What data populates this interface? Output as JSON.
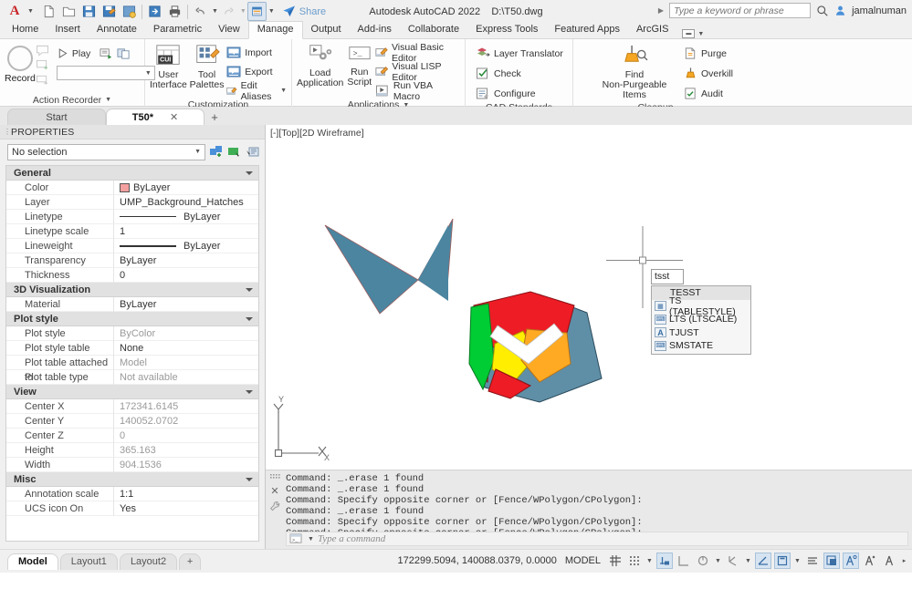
{
  "titlebar": {
    "app_title": "Autodesk AutoCAD 2022",
    "file_path": "D:\\T50.dwg",
    "share_label": "Share",
    "search_placeholder": "Type a keyword or phrase",
    "user_name": "jamalnuman"
  },
  "ribbon_tabs": [
    {
      "label": "Home",
      "active": false
    },
    {
      "label": "Insert",
      "active": false
    },
    {
      "label": "Annotate",
      "active": false
    },
    {
      "label": "Parametric",
      "active": false
    },
    {
      "label": "View",
      "active": false
    },
    {
      "label": "Manage",
      "active": true
    },
    {
      "label": "Output",
      "active": false
    },
    {
      "label": "Add-ins",
      "active": false
    },
    {
      "label": "Collaborate",
      "active": false
    },
    {
      "label": "Express Tools",
      "active": false
    },
    {
      "label": "Featured Apps",
      "active": false
    },
    {
      "label": "ArcGIS",
      "active": false
    }
  ],
  "ribbon": {
    "action_recorder": {
      "title": "Action Recorder",
      "record_label": "Record",
      "play_label": "Play",
      "combo_value": ""
    },
    "customization": {
      "title": "Customization",
      "user_interface_label": "User\nInterface",
      "user_interface_line1": "User",
      "user_interface_line2": "Interface",
      "tool_palettes_line1": "Tool",
      "tool_palettes_line2": "Palettes",
      "import_label": "Import",
      "export_label": "Export",
      "edit_aliases_label": "Edit Aliases"
    },
    "applications": {
      "title": "Applications",
      "load_application_line1": "Load",
      "load_application_line2": "Application",
      "run_script_line1": "Run",
      "run_script_line2": "Script",
      "visual_basic_editor_label": "Visual Basic Editor",
      "visual_lisp_editor_label": "Visual LISP Editor",
      "run_vba_macro_label": "Run VBA Macro"
    },
    "cad_standards": {
      "title": "CAD Standards",
      "layer_translator_label": "Layer Translator",
      "check_label": "Check",
      "configure_label": "Configure"
    },
    "cleanup": {
      "title": "Cleanup",
      "find_non_purgeable_line1": "Find",
      "find_non_purgeable_line2": "Non-Purgeable Items",
      "purge_label": "Purge",
      "overkill_label": "Overkill",
      "audit_label": "Audit"
    }
  },
  "file_tabs": [
    {
      "label": "Start",
      "active": false,
      "closable": false
    },
    {
      "label": "T50*",
      "active": true,
      "closable": true
    }
  ],
  "properties": {
    "panel_title": "PROPERTIES",
    "selection_value": "No selection",
    "groups": [
      {
        "name": "General",
        "rows": [
          {
            "label": "Color",
            "value": "ByLayer",
            "type": "color",
            "swatch": "#f4a0a0",
            "dim": false
          },
          {
            "label": "Layer",
            "value": "UMP_Background_Hatches",
            "type": "text",
            "dim": false
          },
          {
            "label": "Linetype",
            "value": "ByLayer",
            "type": "line",
            "dim": false
          },
          {
            "label": "Linetype scale",
            "value": "1",
            "type": "text",
            "dim": false
          },
          {
            "label": "Lineweight",
            "value": "ByLayer",
            "type": "line",
            "dim": false
          },
          {
            "label": "Transparency",
            "value": "ByLayer",
            "type": "text",
            "dim": false
          },
          {
            "label": "Thickness",
            "value": "0",
            "type": "text",
            "dim": false
          }
        ]
      },
      {
        "name": "3D Visualization",
        "rows": [
          {
            "label": "Material",
            "value": "ByLayer",
            "type": "text",
            "dim": false
          }
        ]
      },
      {
        "name": "Plot style",
        "rows": [
          {
            "label": "Plot style",
            "value": "ByColor",
            "type": "text",
            "dim": true
          },
          {
            "label": "Plot style table",
            "value": "None",
            "type": "text",
            "dim": false
          },
          {
            "label": "Plot table attached to",
            "value": "Model",
            "type": "text",
            "dim": true
          },
          {
            "label": "Plot table type",
            "value": "Not available",
            "type": "text",
            "dim": true
          }
        ]
      },
      {
        "name": "View",
        "rows": [
          {
            "label": "Center X",
            "value": "172341.6145",
            "type": "text",
            "dim": true
          },
          {
            "label": "Center Y",
            "value": "140052.0702",
            "type": "text",
            "dim": true
          },
          {
            "label": "Center Z",
            "value": "0",
            "type": "text",
            "dim": true
          },
          {
            "label": "Height",
            "value": "365.163",
            "type": "text",
            "dim": true
          },
          {
            "label": "Width",
            "value": "904.1536",
            "type": "text",
            "dim": true
          }
        ]
      },
      {
        "name": "Misc",
        "rows": [
          {
            "label": "Annotation scale",
            "value": "1:1",
            "type": "text",
            "dim": false
          },
          {
            "label": "UCS icon On",
            "value": "Yes",
            "type": "text",
            "dim": false
          }
        ]
      }
    ]
  },
  "canvas": {
    "viewport_label": "[-][Top][2D Wireframe]",
    "ucs_x_label": "X",
    "ucs_y_label": "Y"
  },
  "autocomplete": {
    "typed_text": "tsst",
    "items": [
      {
        "label": "TESST",
        "highlighted": true,
        "icon": ""
      },
      {
        "label": "TS (TABLESTYLE)",
        "highlighted": false,
        "icon": "tbl"
      },
      {
        "label": "LTS (LTSCALE)",
        "highlighted": false,
        "icon": "var"
      },
      {
        "label": "TJUST",
        "highlighted": false,
        "icon": "A"
      },
      {
        "label": "SMSTATE",
        "highlighted": false,
        "icon": "var"
      }
    ]
  },
  "command_line": {
    "history": [
      "Command: _.erase 1 found",
      "Command: _.erase 1 found",
      "Command: Specify opposite corner or [Fence/WPolygon/CPolygon]:",
      "Command: _.erase 1 found",
      "Command: Specify opposite corner or [Fence/WPolygon/CPolygon]:",
      "Command: Specify opposite corner or [Fence/WPolygon/CPolygon]:"
    ],
    "placeholder": "Type a command"
  },
  "layout_tabs": [
    {
      "label": "Model",
      "active": true
    },
    {
      "label": "Layout1",
      "active": false
    },
    {
      "label": "Layout2",
      "active": false
    }
  ],
  "statusbar": {
    "coordinates": "172299.5094, 140088.0379, 0.0000",
    "space_label": "MODEL",
    "toggles": [
      {
        "name": "grid-display",
        "on": false
      },
      {
        "name": "snap-mode",
        "on": false
      },
      {
        "name": "ortho-mode",
        "on": true
      },
      {
        "name": "polar-tracking",
        "on": false
      },
      {
        "name": "isometric-drafting",
        "on": false
      },
      {
        "name": "object-snap-tracking",
        "on": false
      },
      {
        "name": "object-snap",
        "on": true
      },
      {
        "name": "lineweight",
        "on": true
      },
      {
        "name": "transparency",
        "on": false
      },
      {
        "name": "selection-cycling",
        "on": true
      },
      {
        "name": "annotation-monitor",
        "on": true
      },
      {
        "name": "annotation-visibility",
        "on": false
      },
      {
        "name": "autoscale",
        "on": false
      }
    ]
  },
  "colors": {
    "accent": "#4a7f99",
    "teal_shape": "#4b85a0",
    "red": "#ee1c25",
    "green": "#00cc33",
    "yellow": "#ffee00",
    "orange": "#ffaa22",
    "slate": "#5f8fa6",
    "brand_red": "#c8262a",
    "link_blue": "#6b9ccc"
  }
}
